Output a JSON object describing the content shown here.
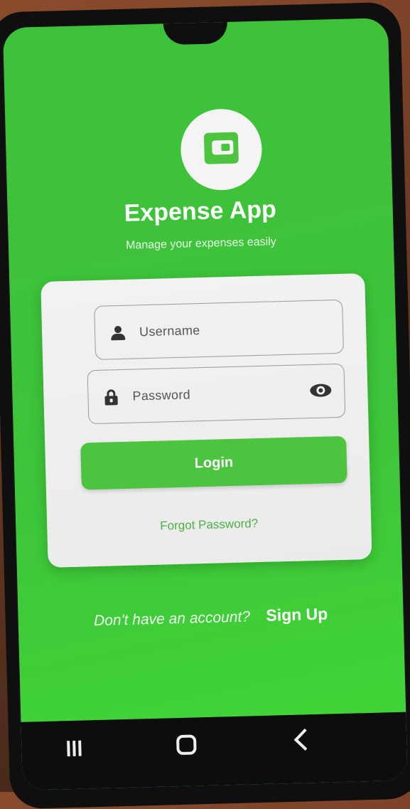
{
  "app": {
    "title": "Expense App",
    "subtitle": "Manage your expenses easily",
    "logo_icon": "wallet-icon"
  },
  "login_form": {
    "username": {
      "placeholder": "Username",
      "icon": "person-icon"
    },
    "password": {
      "placeholder": "Password",
      "icon": "lock-icon",
      "toggle_icon": "eye-icon"
    },
    "login_label": "Login",
    "forgot_label": "Forgot Password?"
  },
  "signup": {
    "prompt": "Don't have an account?",
    "link_label": "Sign Up"
  },
  "system_nav": {
    "recent_icon": "recent-apps-icon",
    "home_icon": "home-icon",
    "back_icon": "back-icon"
  },
  "colors": {
    "primary_green": "#4cc43f",
    "screen_green": "#3ec13a",
    "card_bg": "#f2f2f2",
    "link_green": "#4cb043"
  }
}
